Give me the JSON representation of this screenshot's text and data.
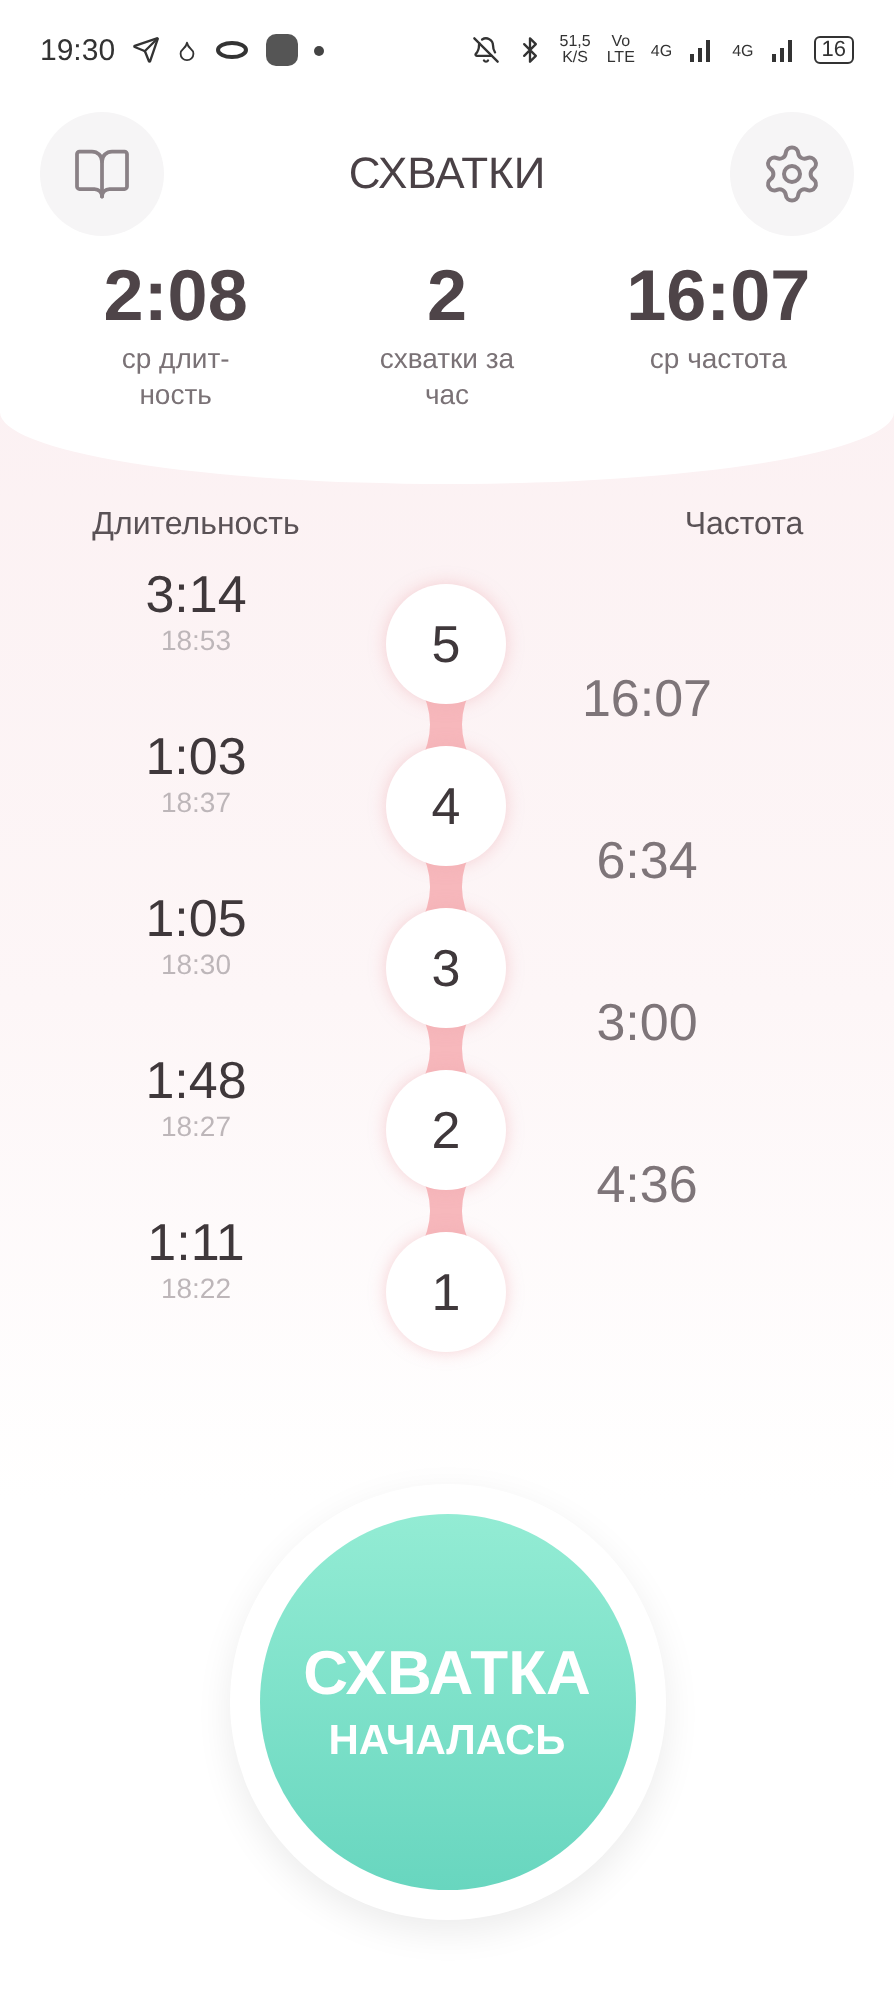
{
  "status_bar": {
    "time": "19:30",
    "speed": "51,5",
    "speed_unit": "K/S",
    "volte_top": "Vo",
    "volte_bottom": "LTE",
    "sim1": "4G",
    "sim2": "4G",
    "battery": "16"
  },
  "header": {
    "title": "СХВАТКИ"
  },
  "stats": [
    {
      "value": "2:08",
      "label": "ср длит-ность"
    },
    {
      "value": "2",
      "label": "схватки за час"
    },
    {
      "value": "16:07",
      "label": "ср частота"
    }
  ],
  "columns": {
    "duration": "Длительность",
    "frequency": "Частота"
  },
  "contractions": [
    {
      "number": "5",
      "duration": "3:14",
      "start": "18:53"
    },
    {
      "number": "4",
      "duration": "1:03",
      "start": "18:37"
    },
    {
      "number": "3",
      "duration": "1:05",
      "start": "18:30"
    },
    {
      "number": "2",
      "duration": "1:48",
      "start": "18:27"
    },
    {
      "number": "1",
      "duration": "1:11",
      "start": "18:22"
    }
  ],
  "intervals": [
    "16:07",
    "6:34",
    "3:00",
    "4:36"
  ],
  "main_button": {
    "line_1": "СХВАТКА",
    "line_2": "НАЧАЛАСЬ"
  }
}
